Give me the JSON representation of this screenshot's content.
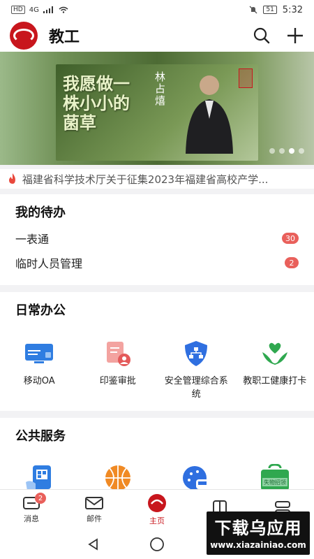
{
  "status_bar": {
    "left_chips": [
      "HD",
      "4G"
    ],
    "battery": "51",
    "time": "5:32"
  },
  "header": {
    "title": "教工",
    "icons": [
      "search-icon",
      "add-icon"
    ]
  },
  "banner": {
    "slogan": "我愿做一株小小的菌草",
    "name": "林占熺",
    "slide_count": 4,
    "active_slide": 3
  },
  "news": {
    "text": "福建省科学技术厅关于征集2023年福建省高校产学..."
  },
  "todo": {
    "title": "我的待办",
    "items": [
      {
        "label": "一表通",
        "count": "30"
      },
      {
        "label": "临时人员管理",
        "count": "2"
      }
    ]
  },
  "daily": {
    "title": "日常办公",
    "items": [
      {
        "label": "移动OA",
        "icon": "monitor-icon"
      },
      {
        "label": "印鉴审批",
        "icon": "seal-approval-icon"
      },
      {
        "label": "安全管理综合系统",
        "icon": "shield-network-icon"
      },
      {
        "label": "教职工健康打卡",
        "icon": "heart-hands-icon"
      }
    ]
  },
  "public": {
    "title": "公共服务",
    "items": [
      {
        "icon": "qr-pay-icon"
      },
      {
        "icon": "basketball-icon"
      },
      {
        "icon": "campus-bus-icon"
      },
      {
        "icon": "lost-found-icon",
        "text": "失物招领"
      }
    ]
  },
  "tabbar": {
    "tabs": [
      {
        "label": "消息",
        "icon": "message-icon",
        "badge": "2"
      },
      {
        "label": "邮件",
        "icon": "mail-icon"
      },
      {
        "label": "主页",
        "icon": "home-logo-icon",
        "active": true
      },
      {
        "label": "",
        "icon": "apps-icon"
      },
      {
        "label": "",
        "icon": "profile-icon"
      }
    ]
  },
  "watermark": {
    "title": "下载乌应用",
    "url": "www.xiazainiao.com"
  },
  "colors": {
    "brand_red": "#c8161d",
    "badge_red": "#e9605b",
    "oa_blue": "#2f7de1",
    "seal_red": "#e45a5a",
    "shield_blue": "#2f6fe0",
    "health_green": "#2fa84f",
    "ball_orange": "#f08a24"
  }
}
